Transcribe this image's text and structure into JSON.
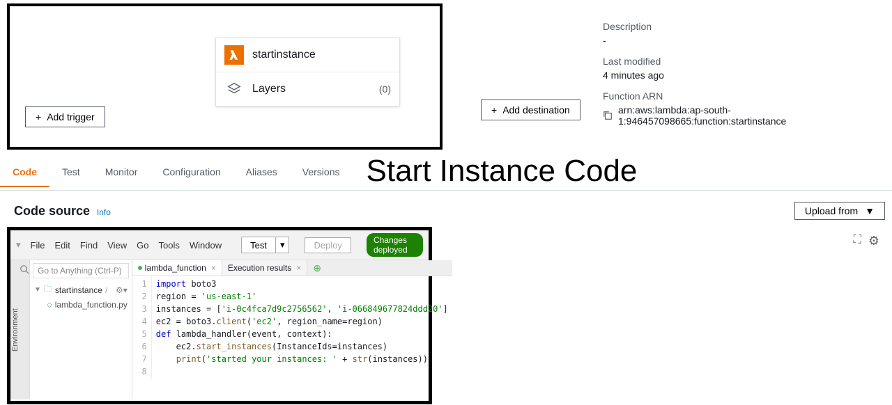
{
  "function": {
    "name": "startinstance",
    "layers_label": "Layers",
    "layers_count": "(0)",
    "add_trigger": "Add trigger",
    "add_destination": "Add destination"
  },
  "info": {
    "desc_label": "Description",
    "desc_value": "-",
    "modified_label": "Last modified",
    "modified_value": "4 minutes ago",
    "arn_label": "Function ARN",
    "arn_value": "arn:aws:lambda:ap-south-1:946457098665:function:startinstance"
  },
  "tabs": {
    "code": "Code",
    "test": "Test",
    "monitor": "Monitor",
    "config": "Configuration",
    "aliases": "Aliases",
    "versions": "Versions"
  },
  "annotation_title": "Start Instance Code",
  "code_source": {
    "title": "Code source",
    "info": "Info",
    "upload": "Upload from"
  },
  "ide": {
    "menus": {
      "file": "File",
      "edit": "Edit",
      "find": "Find",
      "view": "View",
      "go": "Go",
      "tools": "Tools",
      "window": "Window"
    },
    "test_btn": "Test",
    "deploy_btn": "Deploy",
    "status_pill": "Changes deployed",
    "env_label": "Environment",
    "goto_placeholder": "Go to Anything (Ctrl-P)",
    "folder": "startinstance",
    "file": "lambda_function.py",
    "tab_active": "lambda_function",
    "tab_exec": "Execution results",
    "line1a": "import",
    "line1b": " boto3",
    "line2a": "region = ",
    "line2b": "'us-east-1'",
    "line3a": "instances = [",
    "line3b": "'i-0c4fca7d9c2756562'",
    "line3c": ", ",
    "line3d": "'i-066849677824ddd20'",
    "line3e": "]",
    "line4a": "ec2 = boto3.",
    "line4b": "client",
    "line4c": "(",
    "line4d": "'ec2'",
    "line4e": ", region_name=region)",
    "line5": "",
    "line6a": "def",
    "line6b": " lambda_handler(event, context):",
    "line7a": "    ec2.",
    "line7b": "start_instances",
    "line7c": "(InstanceIds=instances)",
    "line8a": "    ",
    "line8b": "print",
    "line8c": "(",
    "line8d": "'started your instances: '",
    "line8e": " + ",
    "line8f": "str",
    "line8g": "(instances))"
  }
}
